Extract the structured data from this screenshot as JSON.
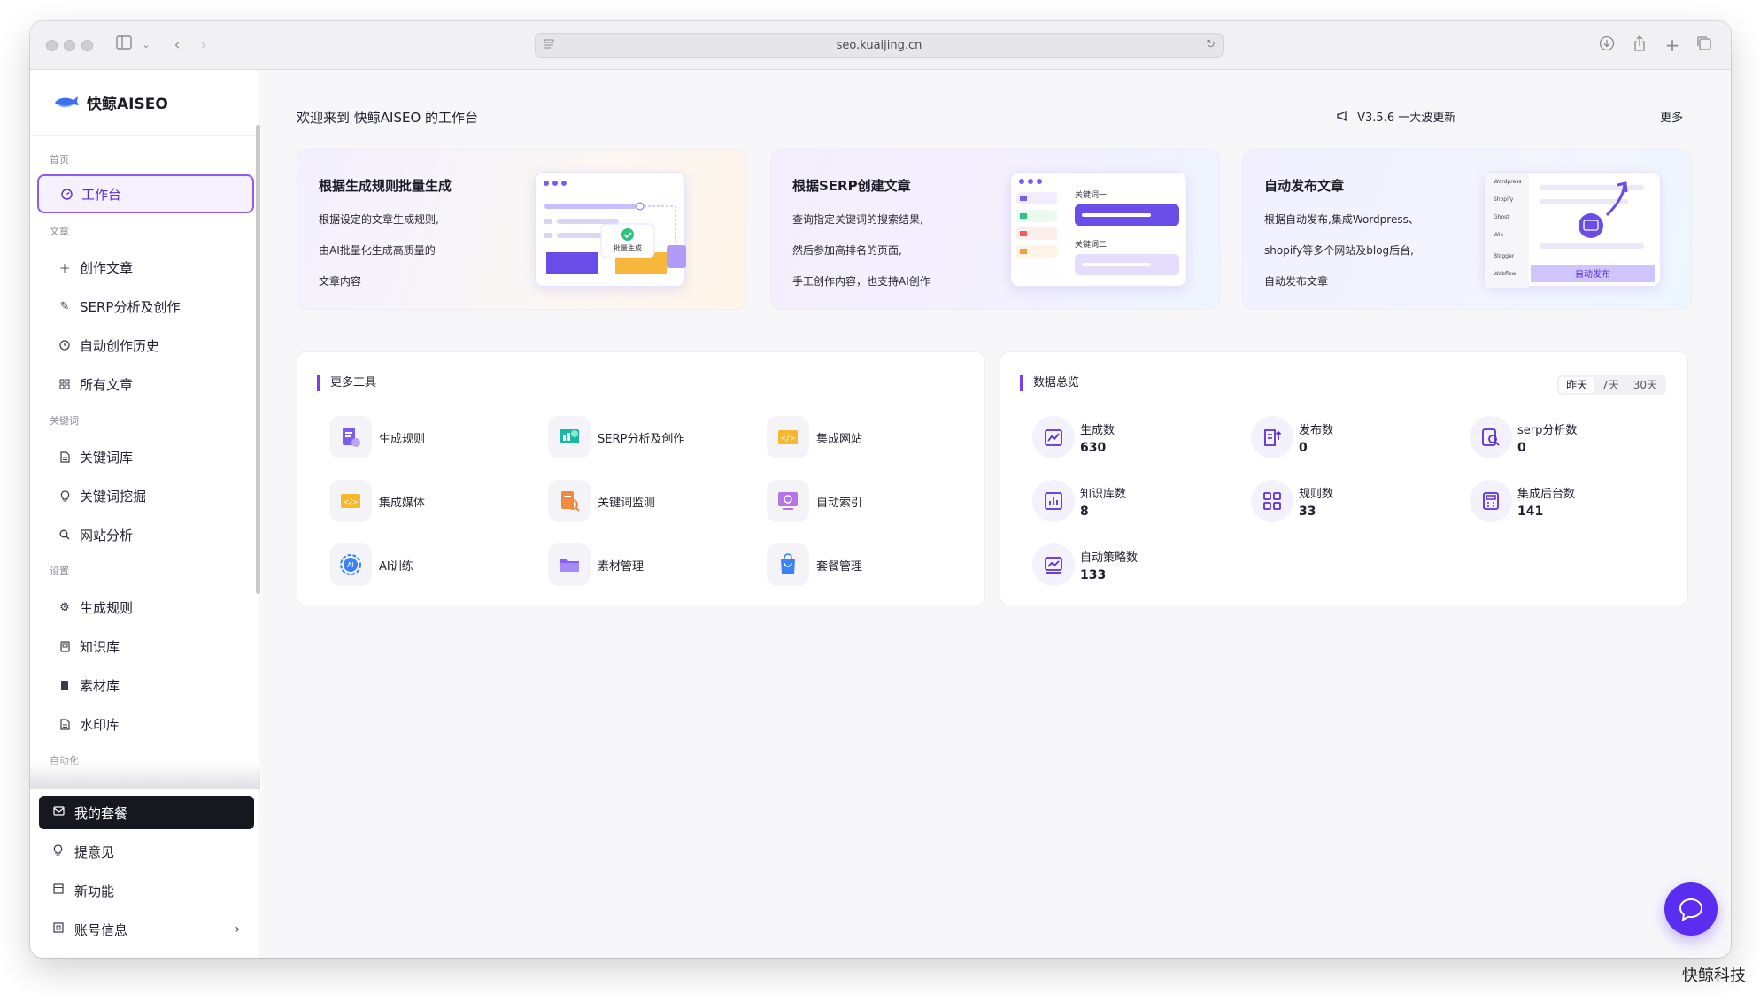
{
  "browser": {
    "url": "seo.kuaijing.cn"
  },
  "sidebar": {
    "brand": "快鲸AISEO",
    "sections": {
      "home": "首页",
      "article": "文章",
      "keyword": "关键词",
      "settings": "设置",
      "automation": "自动化"
    },
    "items": [
      {
        "label": "工作台",
        "icon": "dashboard-icon"
      },
      {
        "label": "创作文章",
        "icon": "plus-icon"
      },
      {
        "label": "SERP分析及创作",
        "icon": "pen-icon"
      },
      {
        "label": "自动创作历史",
        "icon": "clock-icon"
      },
      {
        "label": "所有文章",
        "icon": "grid-icon"
      },
      {
        "label": "关键词库",
        "icon": "doc-icon"
      },
      {
        "label": "关键词挖掘",
        "icon": "bulb-icon"
      },
      {
        "label": "网站分析",
        "icon": "search-icon"
      },
      {
        "label": "生成规则",
        "icon": "gear-icon"
      },
      {
        "label": "知识库",
        "icon": "book-icon"
      },
      {
        "label": "素材库",
        "icon": "box-icon"
      },
      {
        "label": "水印库",
        "icon": "doc-icon"
      }
    ],
    "bottom": [
      {
        "label": "我的套餐",
        "icon": "mail-icon"
      },
      {
        "label": "提意见",
        "icon": "bulb-icon"
      },
      {
        "label": "新功能",
        "icon": "calendar-icon"
      },
      {
        "label": "账号信息",
        "icon": "account-icon"
      }
    ]
  },
  "header": {
    "welcome": "欢迎来到 快鲸AISEO 的工作台",
    "version": "V3.5.6 一大波更新",
    "more": "更多"
  },
  "cards": [
    {
      "title": "根据生成规则批量生成",
      "lines": [
        "根据设定的文章生成规则,",
        "由AI批量化生成高质量的",
        "文章内容"
      ],
      "badge": "批量生成"
    },
    {
      "title": "根据SERP创建文章",
      "lines": [
        "查询指定关键词的搜索结果,",
        "然后参加高排名的页面,",
        "手工创作内容，也支持AI创作"
      ],
      "kw1": "关键词一",
      "kw2": "关键词二"
    },
    {
      "title": "自动发布文章",
      "lines": [
        "根据自动发布,集成Wordpress、",
        "shopify等多个网站及blog后台,",
        "自动发布文章"
      ],
      "platforms": [
        "Wordpress",
        "Shopify",
        "Ghost",
        "Wix",
        "Blogger",
        "Webflow"
      ],
      "button": "自动发布"
    }
  ],
  "tools": {
    "title": "更多工具",
    "items": [
      {
        "label": "生成规则",
        "icon": "rule-icon"
      },
      {
        "label": "SERP分析及创作",
        "icon": "serp-icon"
      },
      {
        "label": "集成网站",
        "icon": "code-window-icon"
      },
      {
        "label": "集成媒体",
        "icon": "media-icon"
      },
      {
        "label": "关键词监测",
        "icon": "monitor-icon"
      },
      {
        "label": "自动索引",
        "icon": "index-icon"
      },
      {
        "label": "AI训练",
        "icon": "ai-icon"
      },
      {
        "label": "素材管理",
        "icon": "folder-icon"
      },
      {
        "label": "套餐管理",
        "icon": "bag-icon"
      }
    ]
  },
  "stats": {
    "title": "数据总览",
    "tabs": [
      "昨天",
      "7天",
      "30天"
    ],
    "items": [
      {
        "label": "生成数",
        "value": "630",
        "icon": "chart-icon"
      },
      {
        "label": "发布数",
        "value": "0",
        "icon": "publish-icon"
      },
      {
        "label": "serp分析数",
        "value": "0",
        "icon": "serp-search-icon"
      },
      {
        "label": "知识库数",
        "value": "8",
        "icon": "bar-chart-icon"
      },
      {
        "label": "规则数",
        "value": "33",
        "icon": "grid-icon"
      },
      {
        "label": "集成后台数",
        "value": "141",
        "icon": "calculator-icon"
      },
      {
        "label": "自动策略数",
        "value": "133",
        "icon": "trend-icon"
      }
    ]
  },
  "watermark": "快鲸科技",
  "colors": {
    "accent": "#7c3cf0",
    "chat": "#5b2df0",
    "active_bg": "#f6f1ff"
  }
}
